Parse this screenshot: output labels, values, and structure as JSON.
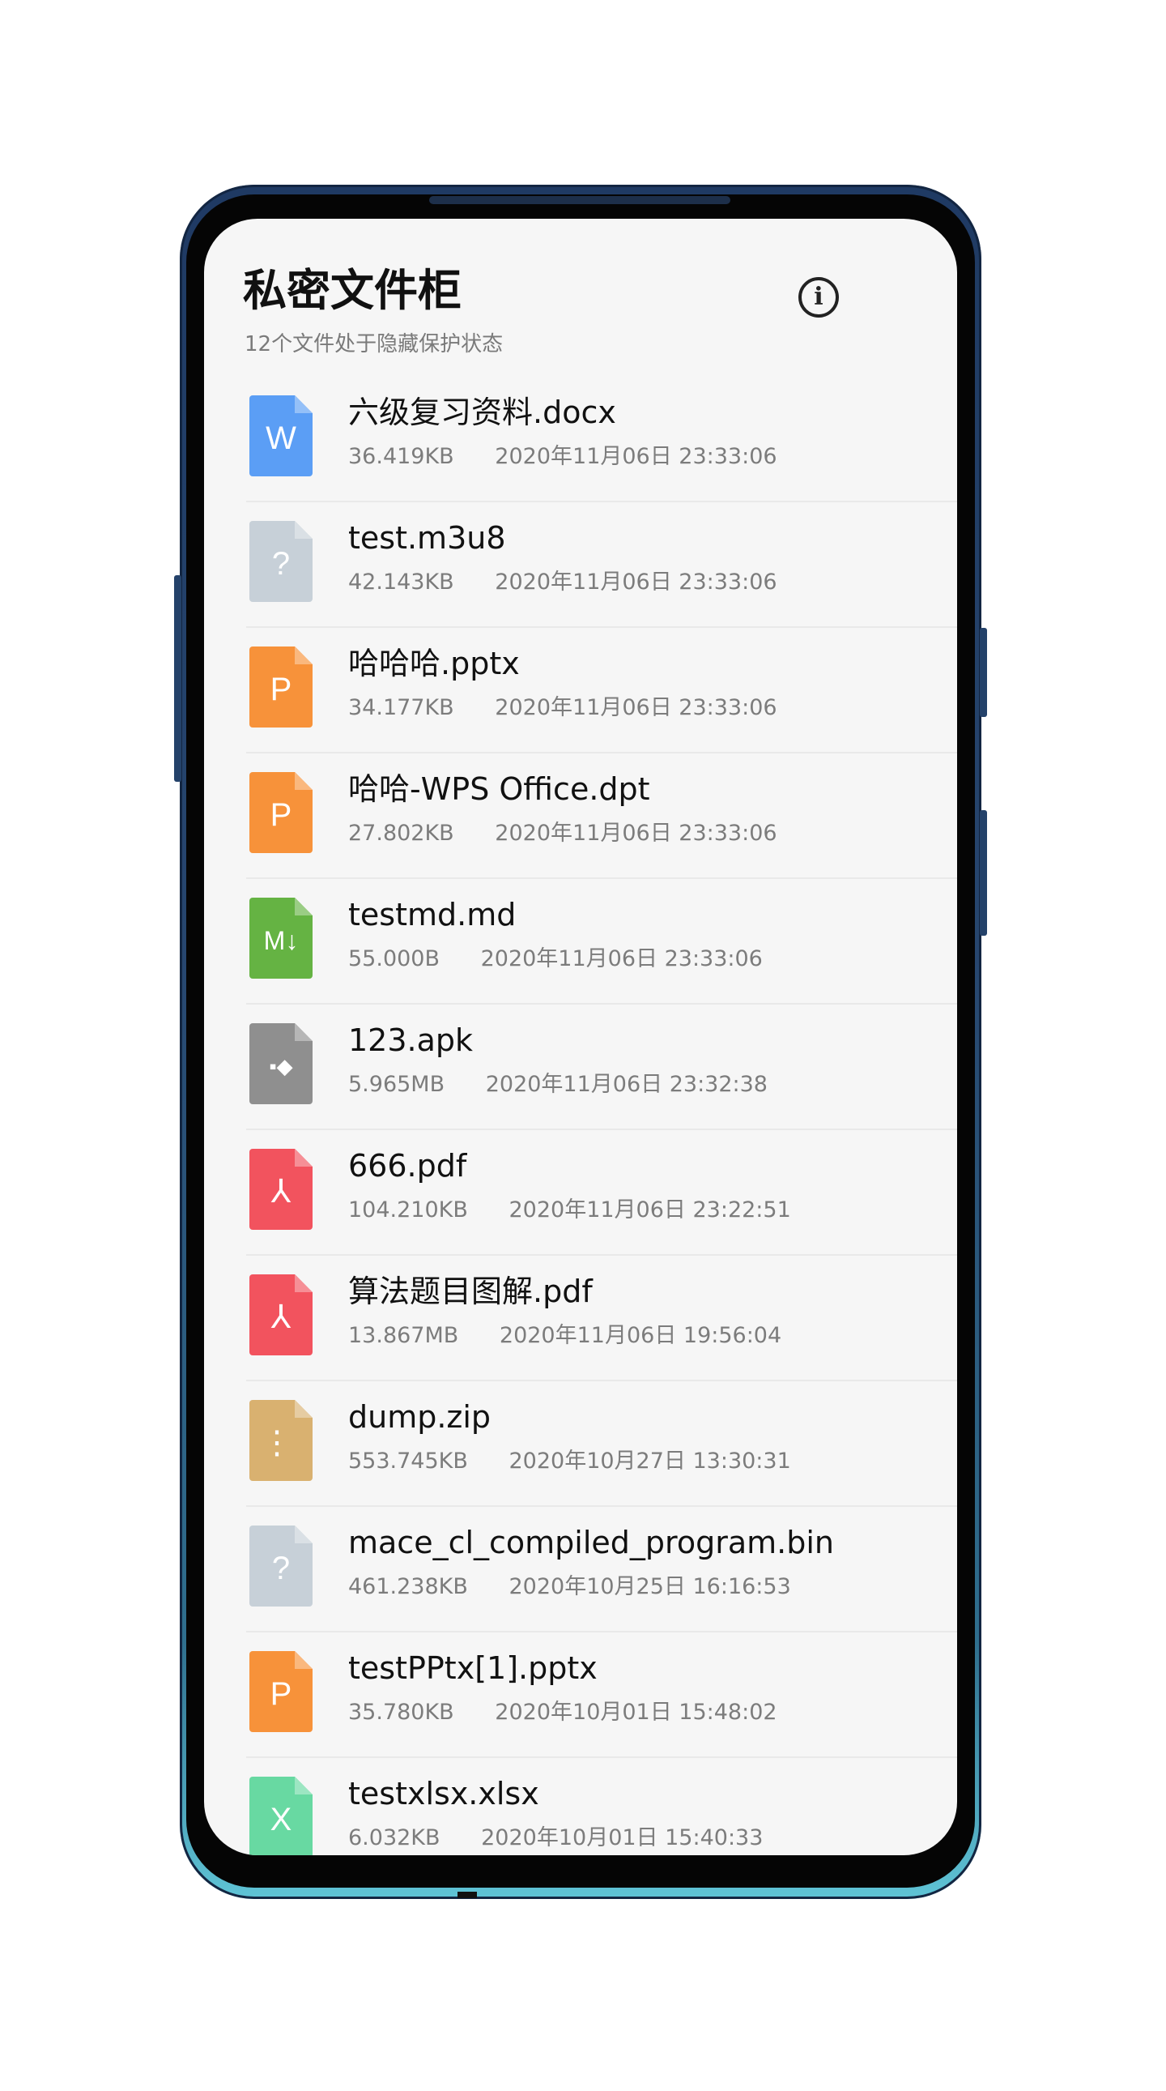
{
  "header": {
    "title": "私密文件柜",
    "subtitle": "12个文件处于隐藏保护状态",
    "info_label": "i"
  },
  "files": [
    {
      "name": "六级复习资料.docx",
      "size": "36.419KB",
      "date": "2020年11月06日 23:33:06",
      "icon": "word-icon",
      "glyph": "W"
    },
    {
      "name": "test.m3u8",
      "size": "42.143KB",
      "date": "2020年11月06日 23:33:06",
      "icon": "unknown-file-icon",
      "glyph": "?"
    },
    {
      "name": "哈哈哈.pptx",
      "size": "34.177KB",
      "date": "2020年11月06日 23:33:06",
      "icon": "powerpoint-icon",
      "glyph": "P"
    },
    {
      "name": "哈哈-WPS Office.dpt",
      "size": "27.802KB",
      "date": "2020年11月06日 23:33:06",
      "icon": "powerpoint-icon",
      "glyph": "P"
    },
    {
      "name": "testmd.md",
      "size": "55.000B",
      "date": "2020年11月06日 23:33:06",
      "icon": "markdown-icon",
      "glyph": "M↓"
    },
    {
      "name": "123.apk",
      "size": "5.965MB",
      "date": "2020年11月06日 23:32:38",
      "icon": "apk-icon",
      "glyph": "▪◆"
    },
    {
      "name": "666.pdf",
      "size": "104.210KB",
      "date": "2020年11月06日 23:22:51",
      "icon": "pdf-icon",
      "glyph": "⅄"
    },
    {
      "name": "算法题目图解.pdf",
      "size": "13.867MB",
      "date": "2020年11月06日 19:56:04",
      "icon": "pdf-icon",
      "glyph": "⅄"
    },
    {
      "name": "dump.zip",
      "size": "553.745KB",
      "date": "2020年10月27日 13:30:31",
      "icon": "zip-icon",
      "glyph": "⋮"
    },
    {
      "name": "mace_cl_compiled_program.bin",
      "size": "461.238KB",
      "date": "2020年10月25日 16:16:53",
      "icon": "unknown-file-icon",
      "glyph": "?"
    },
    {
      "name": "testPPtx[1].pptx",
      "size": "35.780KB",
      "date": "2020年10月01日 15:48:02",
      "icon": "powerpoint-icon",
      "glyph": "P"
    },
    {
      "name": "testxlsx.xlsx",
      "size": "6.032KB",
      "date": "2020年10月01日 15:40:33",
      "icon": "excel-icon",
      "glyph": "X"
    }
  ]
}
